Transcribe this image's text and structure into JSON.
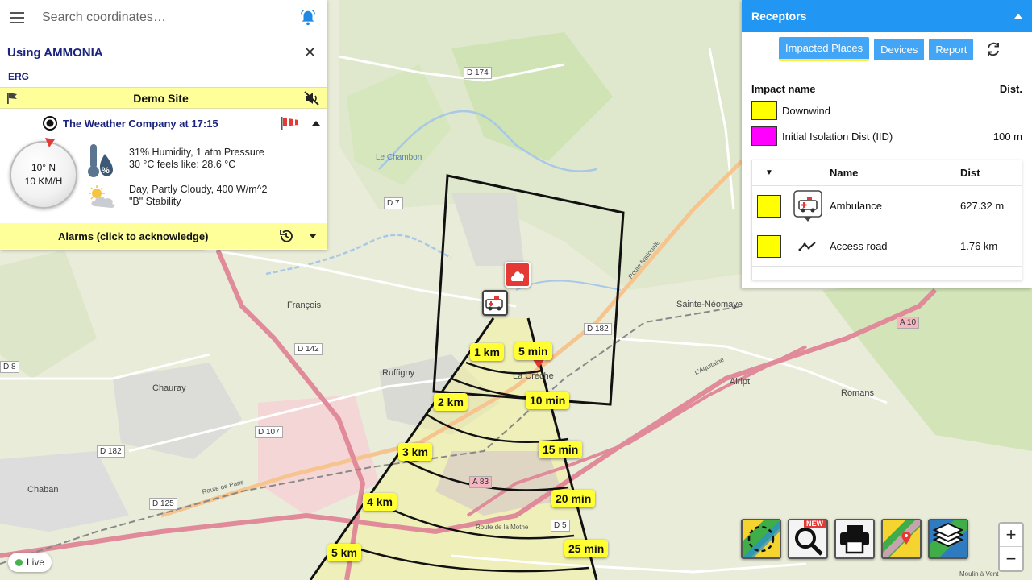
{
  "search": {
    "placeholder": "Search coordinates…"
  },
  "chemical": {
    "title": "Using AMMONIA",
    "erg_link": "ERG"
  },
  "site": {
    "name": "Demo Site"
  },
  "weather": {
    "provider": "The Weather Company at 17:15",
    "wind_direction": "10° N",
    "wind_speed": "10 KM/H",
    "humidity_pressure": "31% Humidity, 1 atm Pressure",
    "temperature": "30 °C feels like: 28.6 °C",
    "conditions": "Day, Partly Cloudy, 400 W/m^2",
    "stability": "\"B\" Stability"
  },
  "alarms": {
    "label": "Alarms (click to acknowledge)"
  },
  "receptors": {
    "title": "Receptors",
    "tabs": [
      "Impacted Places",
      "Devices",
      "Report"
    ],
    "impact_header": {
      "name": "Impact name",
      "dist": "Dist."
    },
    "impacts": [
      {
        "name": "Downwind",
        "dist": "",
        "color": "#ffff00"
      },
      {
        "name": "Initial Isolation Dist (IID)",
        "dist": "100 m",
        "color": "#ff00ff"
      }
    ],
    "table_header": {
      "sort": "▼",
      "name": "Name",
      "dist": "Dist"
    },
    "rows": [
      {
        "name": "Ambulance",
        "dist": "627.32 m",
        "color": "#ffff00",
        "icon": "ambulance-icon"
      },
      {
        "name": "Access road",
        "dist": "1.76 km",
        "color": "#ffff00",
        "icon": "road-line-icon"
      }
    ]
  },
  "map": {
    "places": [
      "François",
      "Ruffigny",
      "Chauray",
      "Chaban",
      "La Crèche",
      "Sainte-Néomaye",
      "Aiript",
      "Romans",
      "Le Chambon"
    ],
    "roads": [
      "D 174",
      "D 7",
      "D 142",
      "D 182",
      "D 107",
      "D 125",
      "A 10",
      "A 83",
      "D 5",
      "D 8",
      "D 182"
    ],
    "road_names": [
      "Route Nationale",
      "Route de Paris",
      "L'Aquitaine",
      "Route de la Mothe",
      "Moulin à Vent"
    ],
    "distance_labels": [
      "1 km",
      "2 km",
      "3 km",
      "4 km",
      "5 km"
    ],
    "time_labels": [
      "5 min",
      "10 min",
      "15 min",
      "20 min",
      "25 min"
    ]
  },
  "tools": {
    "new_badge": "NEW"
  },
  "zoom": {
    "in": "+",
    "out": "−"
  },
  "status": {
    "live": "Live"
  }
}
